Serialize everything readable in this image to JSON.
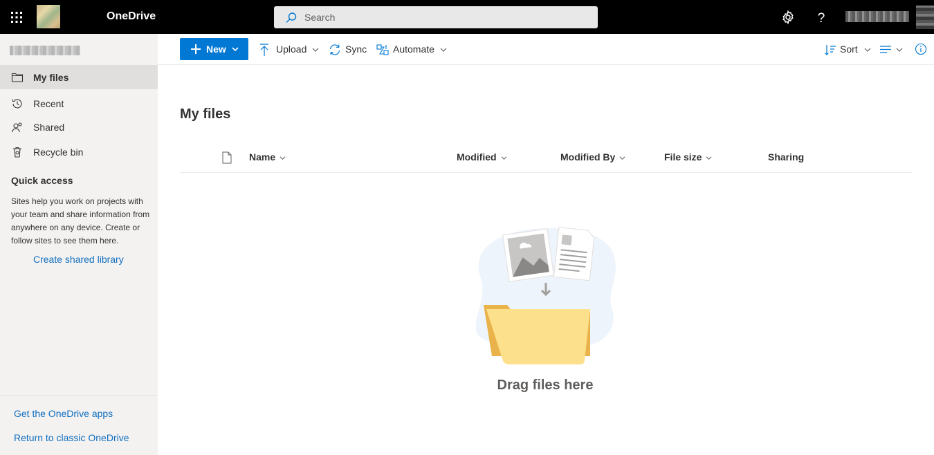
{
  "header": {
    "app_name": "OneDrive",
    "search_placeholder": "Search"
  },
  "nav": {
    "items": [
      {
        "label": "My files",
        "icon": "folder-icon"
      },
      {
        "label": "Recent",
        "icon": "history-icon"
      },
      {
        "label": "Shared",
        "icon": "people-icon"
      },
      {
        "label": "Recycle bin",
        "icon": "recycle-bin-icon"
      }
    ],
    "quick_access_title": "Quick access",
    "quick_access_text": "Sites help you work on projects with your team and share information from anywhere on any device. Create or follow sites to see them here.",
    "create_library_link": "Create shared library",
    "get_apps_link": "Get the OneDrive apps",
    "classic_link": "Return to classic OneDrive"
  },
  "commandbar": {
    "new_label": "New",
    "upload_label": "Upload",
    "sync_label": "Sync",
    "automate_label": "Automate",
    "sort_label": "Sort"
  },
  "main": {
    "title": "My files",
    "columns": [
      "Name",
      "Modified",
      "Modified By",
      "File size",
      "Sharing"
    ],
    "empty_text": "Drag files here"
  },
  "colors": {
    "accent": "#0078d4",
    "link": "#106ebe",
    "topbar": "#000000",
    "nav_bg": "#f3f2f1"
  }
}
